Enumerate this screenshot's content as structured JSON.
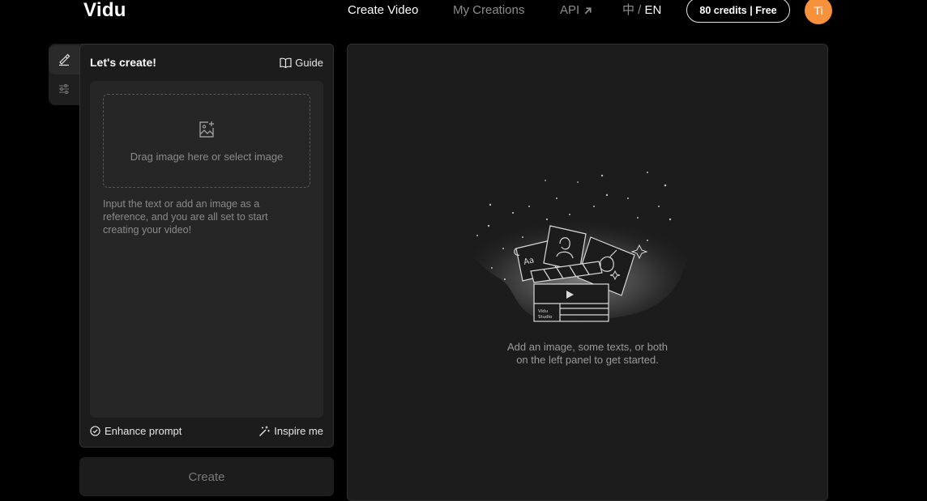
{
  "header": {
    "logo": "Vidu",
    "nav": {
      "create_video": "Create Video",
      "my_creations": "My Creations",
      "api": "API"
    },
    "lang": {
      "zh": "中",
      "sep": " / ",
      "en": "EN"
    },
    "credits_label": "80 credits | Free",
    "avatar_initials": "Ti",
    "avatar_color": "#f7913c"
  },
  "panel": {
    "title": "Let's create!",
    "guide_label": "Guide",
    "dropzone_text": "Drag image here or select image",
    "prompt_placeholder": "Input the text or add an image as a reference, and you are all set to start creating your video!",
    "enhance_label": "Enhance prompt",
    "inspire_label": "Inspire me",
    "create_label": "Create"
  },
  "preview": {
    "empty_line1": "Add an image, some texts, or both",
    "empty_line2": "on the left panel to get started."
  },
  "icons": {
    "tab1": "brush-icon",
    "tab2": "sliders-icon",
    "guide": "book-icon",
    "dropzone": "image-add-icon",
    "enhance": "check-circle-icon",
    "inspire": "magic-wand-icon",
    "api": "arrow-up-right-icon"
  }
}
